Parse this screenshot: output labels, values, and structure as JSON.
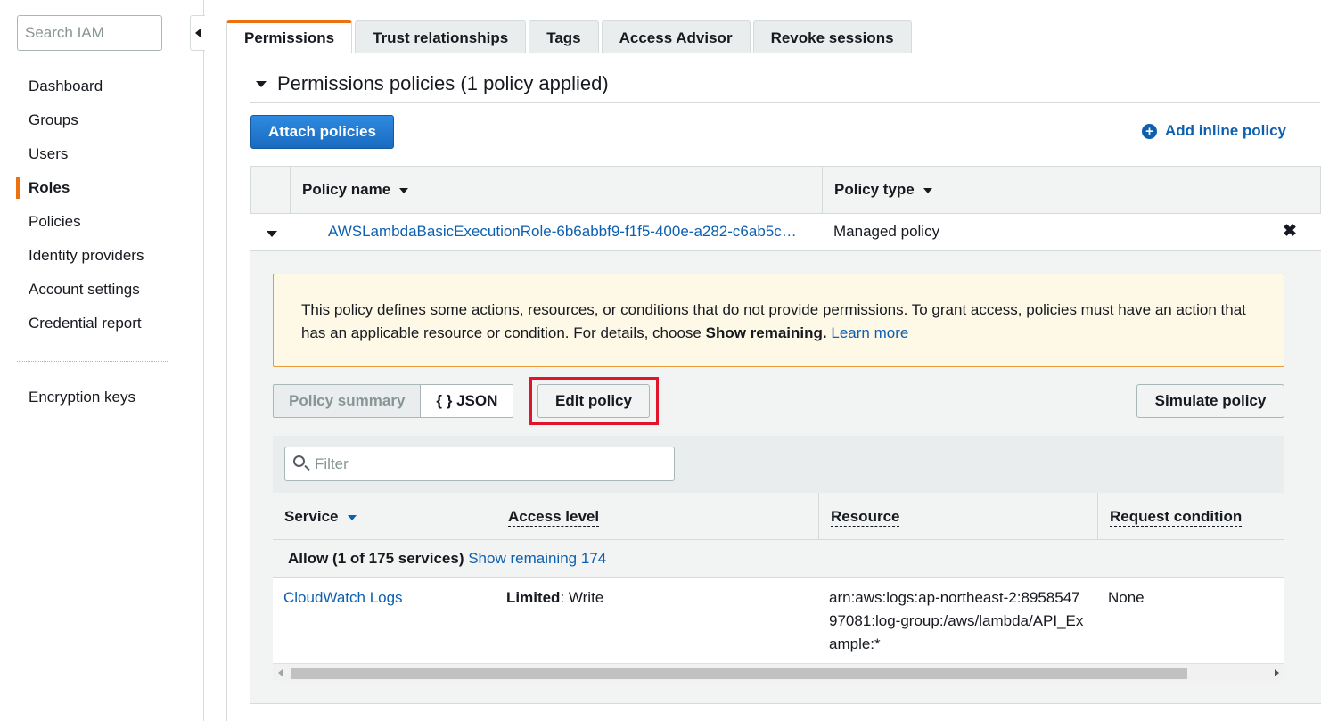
{
  "sidebar": {
    "search_placeholder": "Search IAM",
    "items": [
      {
        "label": "Dashboard"
      },
      {
        "label": "Groups"
      },
      {
        "label": "Users"
      },
      {
        "label": "Roles"
      },
      {
        "label": "Policies"
      },
      {
        "label": "Identity providers"
      },
      {
        "label": "Account settings"
      },
      {
        "label": "Credential report"
      }
    ],
    "active": "Roles",
    "extra_item": "Encryption keys"
  },
  "tabs": [
    {
      "label": "Permissions"
    },
    {
      "label": "Trust relationships"
    },
    {
      "label": "Tags"
    },
    {
      "label": "Access Advisor"
    },
    {
      "label": "Revoke sessions"
    }
  ],
  "section": {
    "title": "Permissions policies (1 policy applied)",
    "attach_button": "Attach policies",
    "add_inline": "Add inline policy"
  },
  "policies_table": {
    "headers": {
      "name": "Policy name",
      "type": "Policy type"
    },
    "rows": [
      {
        "name": "AWSLambdaBasicExecutionRole-6b6abbf9-f1f5-400e-a282-c6ab5c…",
        "type": "Managed policy"
      }
    ]
  },
  "warning": {
    "text_before": "This policy defines some actions, resources, or conditions that do not provide permissions. To grant access, policies must have an action that has an applicable resource or condition. For details, choose ",
    "bold": "Show remaining.",
    "link": "Learn more"
  },
  "policy_view": {
    "summary_label": "Policy summary",
    "json_label": "{ } JSON",
    "edit_label": "Edit policy",
    "simulate_label": "Simulate policy"
  },
  "summary_table": {
    "filter_placeholder": "Filter",
    "headers": {
      "service": "Service",
      "access": "Access level",
      "resource": "Resource",
      "condition": "Request condition"
    },
    "allow_text": "Allow (1 of 175 services)",
    "show_remaining": "Show remaining 174",
    "rows": [
      {
        "service": "CloudWatch Logs",
        "access_bold": "Limited",
        "access_rest": ": Write",
        "resource": "arn:aws:logs:ap-northeast-2:895854797081:log-group:/aws/lambda/API_Example:*",
        "condition": "None"
      }
    ]
  }
}
